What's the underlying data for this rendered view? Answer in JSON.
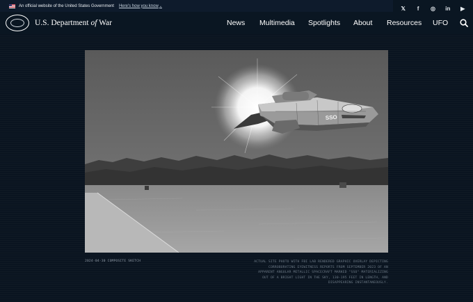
{
  "gov_banner": {
    "text": "An official website of the United States Government",
    "link": "Here's how you know",
    "chevron": "⌄"
  },
  "social": [
    {
      "icon": "x-icon",
      "glyph": "𝕏"
    },
    {
      "icon": "facebook-icon",
      "glyph": "f"
    },
    {
      "icon": "instagram-icon",
      "glyph": "◎"
    },
    {
      "icon": "linkedin-icon",
      "glyph": "in"
    },
    {
      "icon": "youtube-icon",
      "glyph": "▶"
    }
  ],
  "header": {
    "brand_pre": "U.S. Department ",
    "brand_of": "of",
    "brand_post": " War",
    "nav": [
      "News",
      "Multimedia",
      "Spotlights",
      "About",
      "Resources",
      "UFO"
    ]
  },
  "caption": {
    "left": "2024-04-30 COMPOSITE SKETCH",
    "right_lines": [
      "ACTUAL SITE PHOTO WITH FBI LAB RENDERED GRAPHIC OVERLAY DEPICTING",
      "CORROBORATING EYEWITNESS REPORTS FROM SEPTEMBER 2023 OF AN",
      "APPARENT ANGULAR METALLIC SPACECRAFT MARKED \"SSO\" MATERIALIZING",
      "OUT OF A BRIGHT LIGHT IN THE SKY, 130-195 FEET IN LENGTH, AND",
      "DISAPPEARING INSTANTANEOUSLY."
    ]
  },
  "craft_marking": "SSO",
  "colors": {
    "page_bg": "#0a1420",
    "header_bg": "#0a1622",
    "banner_bg": "#0e1b2c"
  }
}
